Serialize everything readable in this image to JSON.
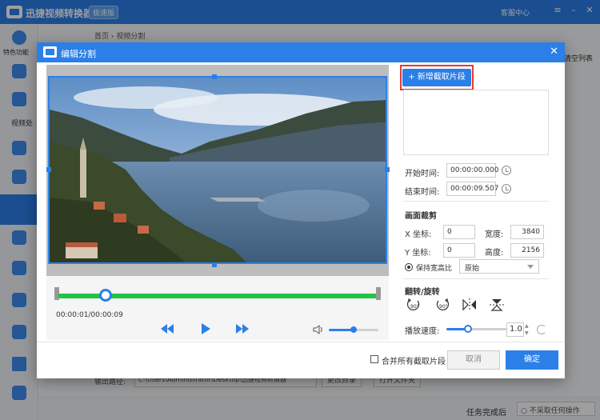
{
  "app": {
    "title": "迅捷视频转换器",
    "edition_badge": "极速版",
    "service": "客服中心",
    "sidebar_top_label": "特色功能",
    "sidebar_section": "视频处",
    "breadcrumb": "首页 › 视频分割",
    "clear_list": "清空列表",
    "output_label": "输出路径:",
    "output_path": "C:\\Users\\Administrator\\Desktop\\迅捷视频转换器",
    "change_dir": "更改目录",
    "open_folder": "打开文件夹",
    "task_done_label": "任务完成后",
    "task_done_value": "不采取任何操作"
  },
  "dialog": {
    "title": "编辑分割",
    "add_segment": "+ 新增截取片段",
    "start_label": "开始时间:",
    "start_value": "00:00:00.000",
    "end_label": "结束时间:",
    "end_value": "00:00:09.507",
    "crop_section": "画面裁剪",
    "x_label": "X 坐标:",
    "x_value": "0",
    "y_label": "Y 坐标:",
    "y_value": "0",
    "w_label": "宽度:",
    "w_value": "3840",
    "h_label": "高度:",
    "h_value": "2156",
    "keep_ratio": "保持宽高比",
    "ratio_value": "原始",
    "rotate_section": "翻转/旋转",
    "rotate_left": "90°",
    "rotate_right": "90°",
    "speed_label": "播放速度:",
    "speed_value": "1.0",
    "speed_fraction": 0.35,
    "volume_fraction": 0.5,
    "time_display": "00:00:01/00:00:09",
    "playhead_fraction": 0.15,
    "merge_all": "合并所有截取片段",
    "cancel": "取消",
    "confirm": "确定"
  },
  "colors": {
    "accent": "#2b7fe8",
    "track": "#22c444",
    "highlight": "#e53935"
  }
}
